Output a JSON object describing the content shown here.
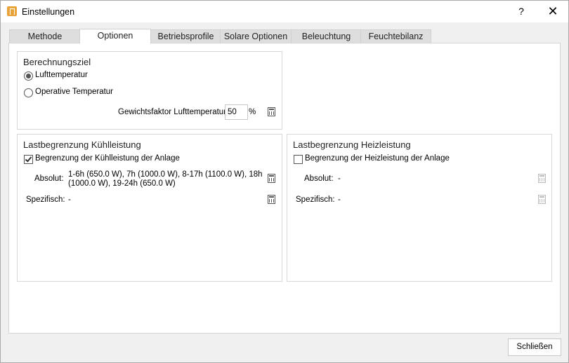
{
  "window": {
    "title": "Einstellungen",
    "help": "?",
    "close": "✕"
  },
  "tabs": [
    {
      "label": "Methode"
    },
    {
      "label": "Optionen"
    },
    {
      "label": "Betriebsprofile"
    },
    {
      "label": "Solare Optionen"
    },
    {
      "label": "Beleuchtung"
    },
    {
      "label": "Feuchtebilanz"
    }
  ],
  "active_tab": "Optionen",
  "berechnungsziel": {
    "title": "Berechnungsziel",
    "option_air": "Lufttemperatur",
    "option_operative": "Operative Temperatur",
    "selected": "Lufttemperatur",
    "weight_label": "Gewichtsfaktor Lufttemperatur",
    "weight_value": "50",
    "weight_unit": "%"
  },
  "cooling": {
    "title": "Lastbegrenzung Kühlleistung",
    "checkbox_label": "Begrenzung der Kühlleistung der Anlage",
    "checked": true,
    "absolute_label": "Absolut:",
    "absolute_line1": "1-6h (650.0 W), 7h (1000.0 W), 8-17h (1100.0 W), 18h",
    "absolute_line2": "(1000.0 W), 19-24h (650.0 W)",
    "specific_label": "Spezifisch:",
    "specific_value": "-"
  },
  "heating": {
    "title": "Lastbegrenzung Heizleistung",
    "checkbox_label": "Begrenzung der Heizleistung der Anlage",
    "checked": false,
    "absolute_label": "Absolut:",
    "absolute_value": "-",
    "specific_label": "Spezifisch:",
    "specific_value": "-"
  },
  "footer": {
    "close_button": "Schließen"
  },
  "icons": {
    "app": "app-icon",
    "calculator": "calculator-icon"
  },
  "colors": {
    "app_icon": "#e8a33a",
    "tab_inactive": "#dedede",
    "panel": "#ffffff",
    "window_bg": "#f0f0f0"
  }
}
